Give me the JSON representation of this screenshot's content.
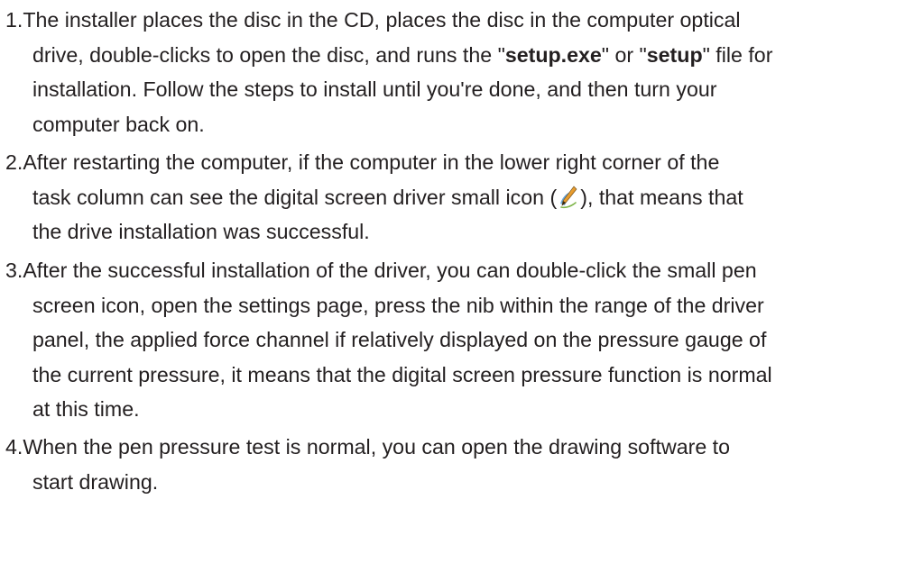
{
  "steps": [
    {
      "number": "1.",
      "lines": [
        "The installer places the disc in the CD, places the disc in the computer optical",
        "drive, double-clicks to open the disc, and runs the \"",
        "setup.exe",
        "\" or \"",
        "setup",
        "\" file for",
        "installation. Follow the steps to install until you're done, and then turn your",
        "computer back on."
      ]
    },
    {
      "number": "2.",
      "line1": "After restarting the computer, if the computer in the lower right corner of the",
      "line2_before_icon": "task column can see the digital screen driver small icon (",
      "line2_after_icon": "), that means that",
      "line3": "the drive installation was successful.",
      "icon": "pen-screen-driver-icon"
    },
    {
      "number": "3.",
      "lines": [
        "After the successful installation of the driver, you can double-click the small pen",
        "screen icon, open the settings page, press the nib within the range of the driver",
        "panel, the applied force channel if relatively displayed on the pressure gauge of",
        "the current pressure, it means that the digital screen pressure function is normal",
        "at this time."
      ]
    },
    {
      "number": "4.",
      "lines": [
        "When the pen pressure test is normal, you can open the drawing software to",
        "start drawing."
      ]
    }
  ]
}
